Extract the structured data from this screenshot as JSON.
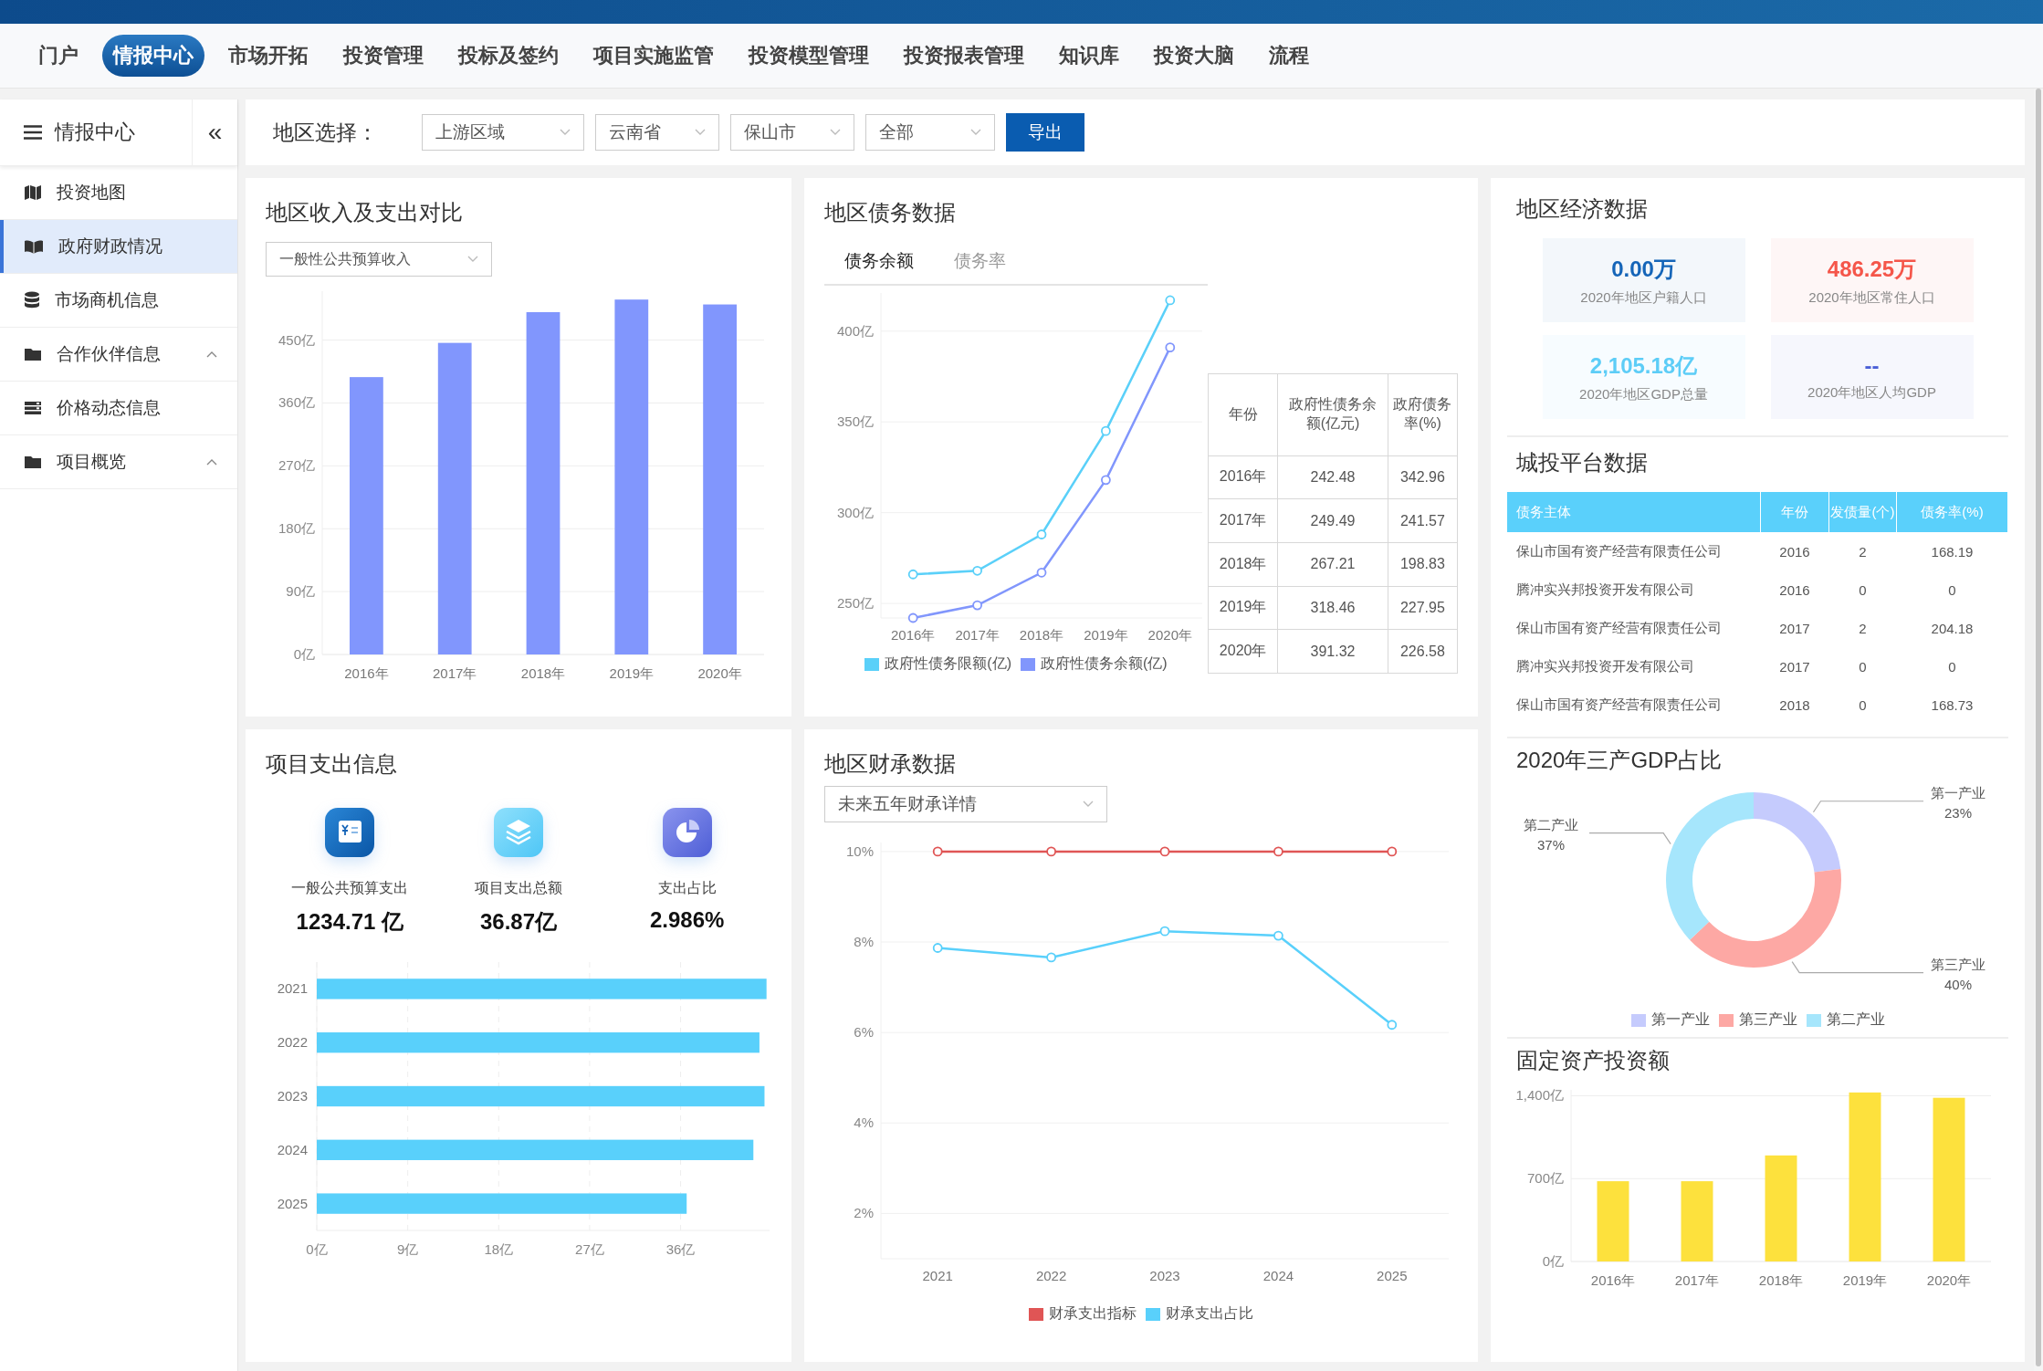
{
  "top_nav": {
    "tabs": [
      {
        "label": "门户",
        "selected": false
      },
      {
        "label": "情报中心",
        "selected": true
      },
      {
        "label": "市场开拓",
        "selected": false
      },
      {
        "label": "投资管理",
        "selected": false
      },
      {
        "label": "投标及签约",
        "selected": false
      },
      {
        "label": "项目实施监管",
        "selected": false
      },
      {
        "label": "投资模型管理",
        "selected": false
      },
      {
        "label": "投资报表管理",
        "selected": false
      },
      {
        "label": "知识库",
        "selected": false
      },
      {
        "label": "投资大脑",
        "selected": false
      },
      {
        "label": "流程",
        "selected": false
      }
    ]
  },
  "sidebar": {
    "title": "情报中心",
    "collapse": "«",
    "items": [
      {
        "label": "投资地图",
        "kind": "link",
        "selected": false
      },
      {
        "label": "政府财政情况",
        "kind": "link",
        "selected": true
      },
      {
        "label": "市场商机信息",
        "kind": "link",
        "selected": false
      },
      {
        "label": "合作伙伴信息",
        "kind": "group",
        "selected": false
      },
      {
        "label": "价格动态信息",
        "kind": "link",
        "selected": false
      },
      {
        "label": "项目概览",
        "kind": "group",
        "selected": false
      }
    ]
  },
  "filter": {
    "label": "地区选择：",
    "selects": [
      {
        "value": "上游区域"
      },
      {
        "value": "云南省"
      },
      {
        "value": "保山市"
      },
      {
        "value": "全部"
      }
    ],
    "button": "导出"
  },
  "income": {
    "title": "地区收入及支出对比",
    "dropdown": {
      "value": "一般性公共预算收入"
    },
    "chart_data": {
      "type": "bar",
      "categories": [
        "2016年",
        "2017年",
        "2018年",
        "2019年",
        "2020年"
      ],
      "grid": true,
      "series": [
        {
          "color": "#8196fd",
          "values": [
            397,
            446,
            490,
            508,
            501
          ]
        }
      ],
      "ylim": [
        0,
        520
      ],
      "yticks": [
        {
          "value": 0,
          "label": "0亿"
        },
        {
          "value": 90,
          "label": "90亿"
        },
        {
          "value": 180,
          "label": "180亿"
        },
        {
          "value": 270,
          "label": "270亿"
        },
        {
          "value": 360,
          "label": "360亿"
        },
        {
          "value": 450,
          "label": "450亿"
        }
      ]
    }
  },
  "debt": {
    "title": "地区债务数据",
    "tabs": [
      {
        "label": "债务余额",
        "selected": true
      },
      {
        "label": "债务率",
        "selected": false
      }
    ],
    "chart_data": {
      "type": "line",
      "categories": [
        "2016年",
        "2017年",
        "2018年",
        "2019年",
        "2020年"
      ],
      "grid": true,
      "series": [
        {
          "name": "政府性债务限额(亿)",
          "color": "#5ad0f9",
          "marker": "circle",
          "values": [
            266,
            268,
            288,
            345,
            417
          ]
        },
        {
          "name": "政府性债务余额(亿)",
          "color": "#8196fc",
          "marker": "circle",
          "values": [
            242,
            249,
            267,
            318,
            391
          ]
        }
      ],
      "ylim": [
        242,
        421
      ],
      "yticks": [
        {
          "value": 250,
          "label": "250亿"
        },
        {
          "value": 300,
          "label": "300亿"
        },
        {
          "value": 350,
          "label": "350亿"
        },
        {
          "value": 400,
          "label": "400亿"
        }
      ]
    },
    "table": {
      "columns": [
        "年份",
        "政府性债务余额(亿元)",
        "政府债务率(%)"
      ],
      "rows": [
        [
          "2016年",
          "242.48",
          "342.96"
        ],
        [
          "2017年",
          "249.49",
          "241.57"
        ],
        [
          "2018年",
          "267.21",
          "198.83"
        ],
        [
          "2019年",
          "318.46",
          "227.95"
        ],
        [
          "2020年",
          "391.32",
          "226.58"
        ]
      ]
    }
  },
  "economy": {
    "title": "地区经济数据",
    "stats": [
      {
        "value": "0.00万",
        "label": "2020年地区户籍人口",
        "color": "#1565b8"
      },
      {
        "value": "486.25万",
        "label": "2020年地区常住人口",
        "color": "#f5564a"
      },
      {
        "value": "2,105.18亿",
        "label": "2020年地区GDP总量",
        "color": "#5dcdf7"
      },
      {
        "value": "--",
        "label": "2020年地区人均GDP",
        "color": "#4a5fd6"
      }
    ]
  },
  "platform": {
    "title": "城投平台数据",
    "table": {
      "columns": [
        "债务主体",
        "年份",
        "发债量(个)",
        "债务率(%)"
      ],
      "rows": [
        [
          "保山市国有资产经营有限责任公司",
          "2016",
          "2",
          "168.19"
        ],
        [
          "腾冲实兴邦投资开发有限公司",
          "2016",
          "0",
          "0"
        ],
        [
          "保山市国有资产经营有限责任公司",
          "2017",
          "2",
          "204.18"
        ],
        [
          "腾冲实兴邦投资开发有限公司",
          "2017",
          "0",
          "0"
        ],
        [
          "保山市国有资产经营有限责任公司",
          "2018",
          "0",
          "168.73"
        ]
      ]
    }
  },
  "expenditure": {
    "title": "项目支出信息",
    "stats": [
      {
        "label": "一般公共预算支出",
        "value": "1234.71 亿"
      },
      {
        "label": "项目支出总额",
        "value": "36.87亿"
      },
      {
        "label": "支出占比",
        "value": "2.986%"
      }
    ],
    "chart_data": {
      "type": "bar",
      "orientation": "horizontal",
      "categories": [
        "2021",
        "2022",
        "2023",
        "2024",
        "2025"
      ],
      "grid": true,
      "series": [
        {
          "color": "#59d0fb",
          "values": [
            44.5,
            43.8,
            44.3,
            43.2,
            36.6
          ]
        }
      ],
      "xlim": [
        0,
        44.8
      ],
      "xticks": [
        {
          "value": 0,
          "label": "0亿"
        },
        {
          "value": 9,
          "label": "9亿"
        },
        {
          "value": 18,
          "label": "18亿"
        },
        {
          "value": 27,
          "label": "27亿"
        },
        {
          "value": 36,
          "label": "36亿"
        }
      ]
    }
  },
  "fiscal": {
    "title": "地区财承数据",
    "dropdown": {
      "value": "未来五年财承详情"
    },
    "chart_data": {
      "type": "line",
      "categories": [
        "2021",
        "2022",
        "2023",
        "2024",
        "2025"
      ],
      "grid": true,
      "series": [
        {
          "name": "财承支出指标",
          "color": "#e05555",
          "marker": "circle",
          "values": [
            10,
            10,
            10,
            10,
            10
          ]
        },
        {
          "name": "财承支出占比",
          "color": "#59d0fb",
          "marker": "circle",
          "values": [
            7.87,
            7.66,
            8.24,
            8.14,
            6.17
          ]
        }
      ],
      "ylim": [
        1,
        10.2
      ],
      "yticks": [
        {
          "value": 2,
          "label": "2%"
        },
        {
          "value": 4,
          "label": "4%"
        },
        {
          "value": 6,
          "label": "6%"
        },
        {
          "value": 8,
          "label": "8%"
        },
        {
          "value": 10,
          "label": "10%"
        }
      ]
    }
  },
  "gdp_share": {
    "title": "2020年三产GDP占比",
    "chart_data": {
      "type": "donut",
      "categories": [
        "第一产业",
        "第三产业",
        "第二产业"
      ],
      "values": [
        23,
        40,
        37
      ],
      "value_labels": [
        "23%",
        "40%",
        "37%"
      ]
    },
    "legend": [
      {
        "label": "第一产业",
        "color": "#c5cbfd"
      },
      {
        "label": "第三产业",
        "color": "#fda8a4"
      },
      {
        "label": "第二产业",
        "color": "#a6e6fc"
      }
    ]
  },
  "fixed_assets": {
    "title": "固定资产投资额",
    "chart_data": {
      "type": "bar",
      "categories": [
        "2016年",
        "2017年",
        "2018年",
        "2019年",
        "2020年"
      ],
      "grid": true,
      "series": [
        {
          "color": "#fde13d",
          "values": [
            678,
            678,
            896,
            1428,
            1383
          ]
        }
      ],
      "ylim": [
        0,
        1450
      ],
      "yticks": [
        {
          "value": 0,
          "label": "0亿"
        },
        {
          "value": 700,
          "label": "700亿"
        },
        {
          "value": 1400,
          "label": "1,400亿"
        }
      ]
    }
  }
}
